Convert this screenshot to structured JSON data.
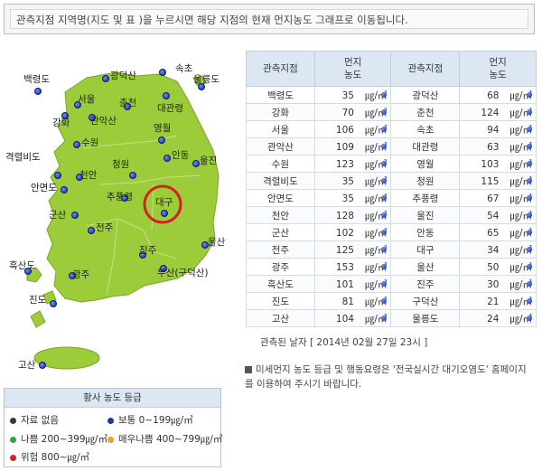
{
  "notice": "관측지점 지역명(지도 및 표 )을 누르시면 해당 지점의 현재 먼지농도 그래프로 이동됩니다.",
  "map": {
    "labels": [
      "백령도",
      "광덕산",
      "속초",
      "울릉도",
      "서울",
      "춘천",
      "대관령",
      "강화",
      "관악산",
      "영월",
      "수원",
      "안동",
      "울진",
      "격렬비도",
      "천안",
      "청원",
      "안면도",
      "추풍령",
      "대구",
      "군산",
      "전주",
      "진주",
      "울산",
      "흑산도",
      "광주",
      "부산(구덕산)",
      "진도",
      "고산"
    ]
  },
  "table": {
    "headers": {
      "site": "관측지점",
      "conc_line1": "먼지",
      "conc_line2": "농도"
    },
    "unit": "㎍/㎥",
    "rows": [
      {
        "s1": "백령도",
        "v1": "35",
        "s2": "광덕산",
        "v2": "68"
      },
      {
        "s1": "강화",
        "v1": "70",
        "s2": "춘천",
        "v2": "124"
      },
      {
        "s1": "서울",
        "v1": "106",
        "s2": "속초",
        "v2": "94"
      },
      {
        "s1": "관악산",
        "v1": "109",
        "s2": "대관령",
        "v2": "63"
      },
      {
        "s1": "수원",
        "v1": "123",
        "s2": "영월",
        "v2": "103"
      },
      {
        "s1": "격렬비도",
        "v1": "35",
        "s2": "청원",
        "v2": "115"
      },
      {
        "s1": "안면도",
        "v1": "35",
        "s2": "추풍령",
        "v2": "67"
      },
      {
        "s1": "천안",
        "v1": "128",
        "s2": "울진",
        "v2": "54"
      },
      {
        "s1": "군산",
        "v1": "102",
        "s2": "안동",
        "v2": "65"
      },
      {
        "s1": "전주",
        "v1": "125",
        "s2": "대구",
        "v2": "34"
      },
      {
        "s1": "광주",
        "v1": "153",
        "s2": "울산",
        "v2": "50"
      },
      {
        "s1": "흑산도",
        "v1": "101",
        "s2": "진주",
        "v2": "30"
      },
      {
        "s1": "진도",
        "v1": "81",
        "s2": "구덕산",
        "v2": "21"
      },
      {
        "s1": "고산",
        "v1": "104",
        "s2": "울릉도",
        "v2": "24"
      }
    ]
  },
  "observed": {
    "label": "관측된 날자",
    "value": "[ 2014년 02월 27일 23시 ]"
  },
  "note": "미세먼지 농도 등급 및 행동요령은 '전국실시간 대기오염도' 홈페이지를 이용하여 주시기 바랍니다.",
  "legend": {
    "title": "황사 농도 등급",
    "items": [
      {
        "label": "자료 없음",
        "color": "#3a3a3a"
      },
      {
        "label": "보통 0~199㎍/㎥",
        "color": "#1a3aa8"
      },
      {
        "label": "나쁨 200~399㎍/㎥",
        "color": "#2aa84a"
      },
      {
        "label": "매우나쁨 400~799㎍/㎥",
        "color": "#f0a020"
      },
      {
        "label": "위험 800~㎍/㎥",
        "color": "#d82020"
      }
    ]
  },
  "colors": {
    "land": "#9ccc3a",
    "land_stroke": "#7aa52c",
    "highlight": "#d42020"
  }
}
